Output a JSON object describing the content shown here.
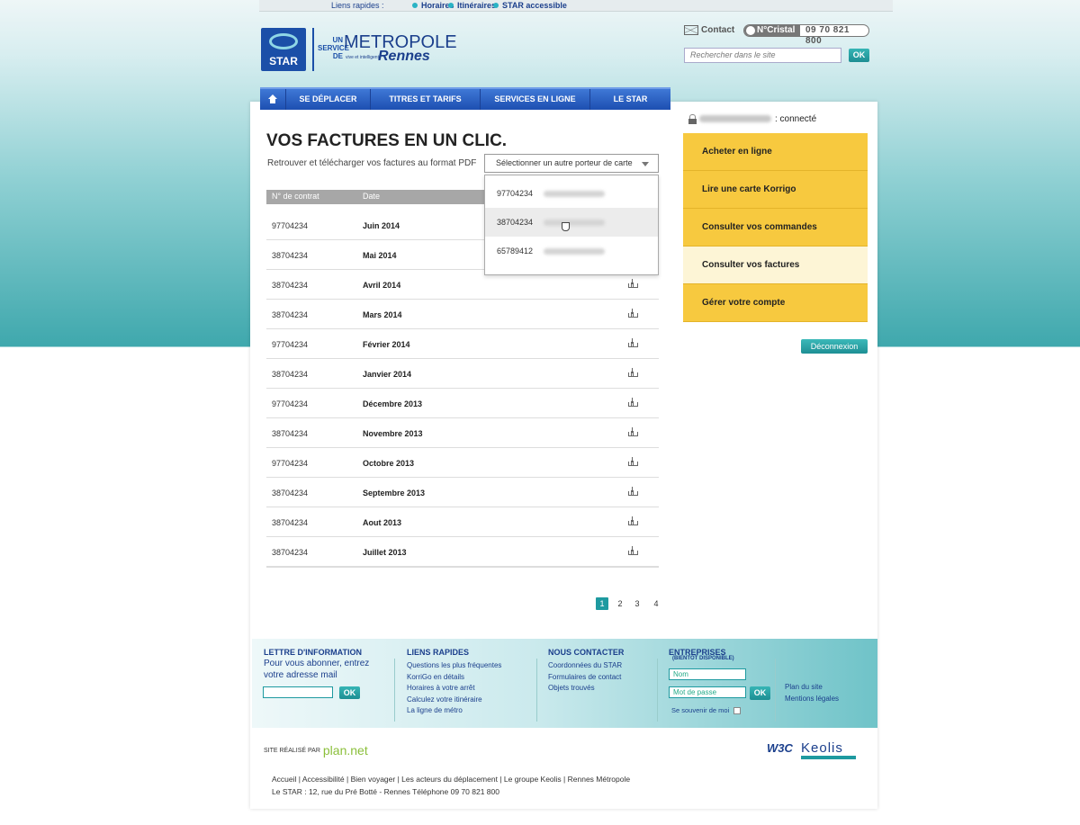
{
  "topbar": {
    "label": "Liens rapides :",
    "links": [
      "Horaires",
      "Itinéraires",
      "STAR accessible"
    ]
  },
  "logo": {
    "star": "STAR",
    "service_lines": [
      "UN",
      "SERVICE",
      "DE"
    ],
    "metropole": "METROPOLE",
    "rennes": "Rennes",
    "tagline": "vive et intelligente"
  },
  "header": {
    "contact_label": "Contact",
    "cristal_tag": "N°Cristal",
    "cristal_number": "09 70 821 800",
    "search_placeholder": "Rechercher dans le site",
    "search_button": "OK"
  },
  "nav": {
    "items": [
      "SE DÉPLACER",
      "TITRES ET TARIFS",
      "SERVICES EN LIGNE",
      "LE STAR"
    ]
  },
  "main": {
    "title": "VOS FACTURES EN UN CLIC.",
    "subtitle": "Retrouver et télécharger vos factures au format PDF",
    "select_label": "Sélectionner un autre porteur de carte",
    "dropdown": [
      {
        "contract": "97704234",
        "name": "Pierrick Fouques"
      },
      {
        "contract": "38704234",
        "name": "Christian Fouques"
      },
      {
        "contract": "65789412",
        "name": "Sylvain Montelaude"
      }
    ],
    "table_headers": {
      "contract": "N° de contrat",
      "date": "Date"
    },
    "invoices": [
      {
        "contract": "97704234",
        "date": "Juin 2014"
      },
      {
        "contract": "38704234",
        "date": "Mai 2014"
      },
      {
        "contract": "38704234",
        "date": "Avril 2014"
      },
      {
        "contract": "38704234",
        "date": "Mars 2014"
      },
      {
        "contract": "97704234",
        "date": "Février 2014"
      },
      {
        "contract": "38704234",
        "date": "Janvier 2014"
      },
      {
        "contract": "97704234",
        "date": "Décembre 2013"
      },
      {
        "contract": "38704234",
        "date": "Novembre 2013"
      },
      {
        "contract": "97704234",
        "date": "Octobre 2013"
      },
      {
        "contract": "38704234",
        "date": "Septembre 2013"
      },
      {
        "contract": "38704234",
        "date": "Aout 2013"
      },
      {
        "contract": "38704234",
        "date": "Juillet 2013"
      }
    ],
    "pages": [
      "1",
      "2",
      "3",
      "4"
    ],
    "current_page": "1"
  },
  "sidebar": {
    "user_name": "Pierrick Fouques",
    "connected_label": ": connecté",
    "menu": [
      "Acheter en ligne",
      "Lire une carte Korrigo",
      "Consulter vos commandes",
      "Consulter vos factures",
      "Gérer votre compte"
    ],
    "active_index": 3,
    "logout_label": "Déconnexion"
  },
  "footer": {
    "newsletter": {
      "title": "LETTRE D'INFORMATION",
      "text_line1": "Pour vous abonner, entrez",
      "text_line2": "votre adresse mail",
      "button": "OK"
    },
    "quick_links": {
      "title": "LIENS RAPIDES",
      "items": [
        "Questions les plus fréquentes",
        "KorriGo en détails",
        "Horaires à votre arrêt",
        "Calculez votre itinéraire",
        "La ligne de métro"
      ]
    },
    "contact": {
      "title": "NOUS CONTACTER",
      "items": [
        "Coordonnées du STAR",
        "Formulaires de contact",
        "Objets trouvés"
      ]
    },
    "business": {
      "title": "ENTREPRISES",
      "subtitle": "(BIENTÔT DISPONIBLE)",
      "name_placeholder": "Nom",
      "password_placeholder": "Mot de passe",
      "button": "OK",
      "remember": "Se souvenir de moi"
    },
    "extra": {
      "items": [
        "Plan du site",
        "Mentions légales"
      ]
    }
  },
  "bottom": {
    "credit_prefix": "SITE RÉALISÉ PAR",
    "credit_name": "plan.net",
    "w3c": "W3C",
    "keolis": "Keolis",
    "links": [
      "Accueil",
      "Accessibilité",
      "Bien voyager",
      "Les acteurs du déplacement",
      "Le groupe Keolis",
      "Rennes Métropole"
    ],
    "address": "Le STAR : 12, rue du Pré Botté - Rennes Téléphone 09 70 821 800"
  },
  "colors": {
    "brand_blue": "#1b4fa8",
    "teal": "#1e9aa0",
    "menu_yellow": "#f7c93f",
    "menu_active": "#fdf5d6"
  }
}
